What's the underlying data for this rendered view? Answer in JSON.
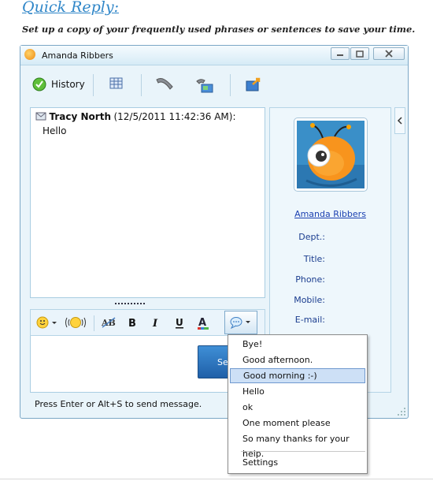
{
  "page": {
    "heading": "Quick Reply:",
    "subheading": "Set up a copy of your frequently used phrases or sentences to save your time."
  },
  "window": {
    "title": "Amanda Ribbers",
    "toolbar": {
      "history_label": "History"
    },
    "chat": {
      "sender": "Tracy North",
      "timestamp": "(12/5/2011 11:42:36 AM):",
      "message": "Hello"
    },
    "send_button_label": "Se",
    "status": "Press Enter or Alt+S to send message.",
    "profile": {
      "name": "Amanda Ribbers",
      "fields": [
        "Dept.:",
        "Title:",
        "Phone:",
        "Mobile:",
        "E-mail:"
      ]
    }
  },
  "quick_reply_menu": {
    "items": [
      "Bye!",
      "Good afternoon.",
      "Good morning :-)",
      "Hello",
      "ok",
      "One moment please",
      "So many thanks for your help."
    ],
    "selected_index": 2,
    "settings_label": "Settings"
  },
  "colors": {
    "heading": "#2f86c8",
    "window_bg": "#e9f4fa",
    "link": "#1a3fb0",
    "selection": "#cde0f6"
  }
}
